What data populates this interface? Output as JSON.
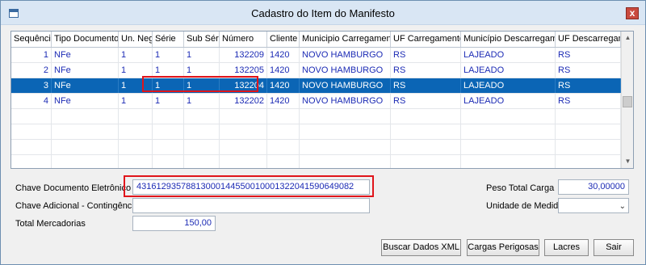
{
  "window": {
    "title": "Cadastro do Item do Manifesto",
    "close_label": "x"
  },
  "grid": {
    "columns": [
      "Sequência",
      "Tipo Documento",
      "Un. Neg.",
      "Série",
      "Sub Série",
      "Número",
      "Cliente",
      "Municipio Carregamento",
      "UF Carregamento",
      "Município Descarregamento",
      "UF Descarregamento"
    ],
    "rows": [
      [
        "1",
        "NFe",
        "1",
        "1",
        "1",
        "132209",
        "1420",
        "NOVO HAMBURGO",
        "RS",
        "LAJEADO",
        "RS"
      ],
      [
        "2",
        "NFe",
        "1",
        "1",
        "1",
        "132205",
        "1420",
        "NOVO HAMBURGO",
        "RS",
        "LAJEADO",
        "RS"
      ],
      [
        "3",
        "NFe",
        "1",
        "1",
        "1",
        "132204",
        "1420",
        "NOVO HAMBURGO",
        "RS",
        "LAJEADO",
        "RS"
      ],
      [
        "4",
        "NFe",
        "1",
        "1",
        "1",
        "132202",
        "1420",
        "NOVO HAMBURGO",
        "RS",
        "LAJEADO",
        "RS"
      ]
    ],
    "selected_row": 2
  },
  "form": {
    "chave_label": "Chave Documento Eletrônico",
    "chave_value": "43161293578813000144550010001322041590649082",
    "chave_adicional_label": "Chave Adicional - Contingência FS",
    "chave_adicional_value": "",
    "total_label": "Total Mercadorias",
    "total_value": "150,00",
    "peso_label": "Peso Total Carga",
    "peso_value": "30,00000",
    "unidade_label": "Unidade de Medida",
    "unidade_value": ""
  },
  "buttons": {
    "buscar": "Buscar Dados XML",
    "cargas": "Cargas Perigosas",
    "lacres": "Lacres",
    "sair": "Sair"
  },
  "colors": {
    "selection": "#0b65b5",
    "cell_text": "#1c2bb5",
    "highlight": "#e0151b"
  }
}
